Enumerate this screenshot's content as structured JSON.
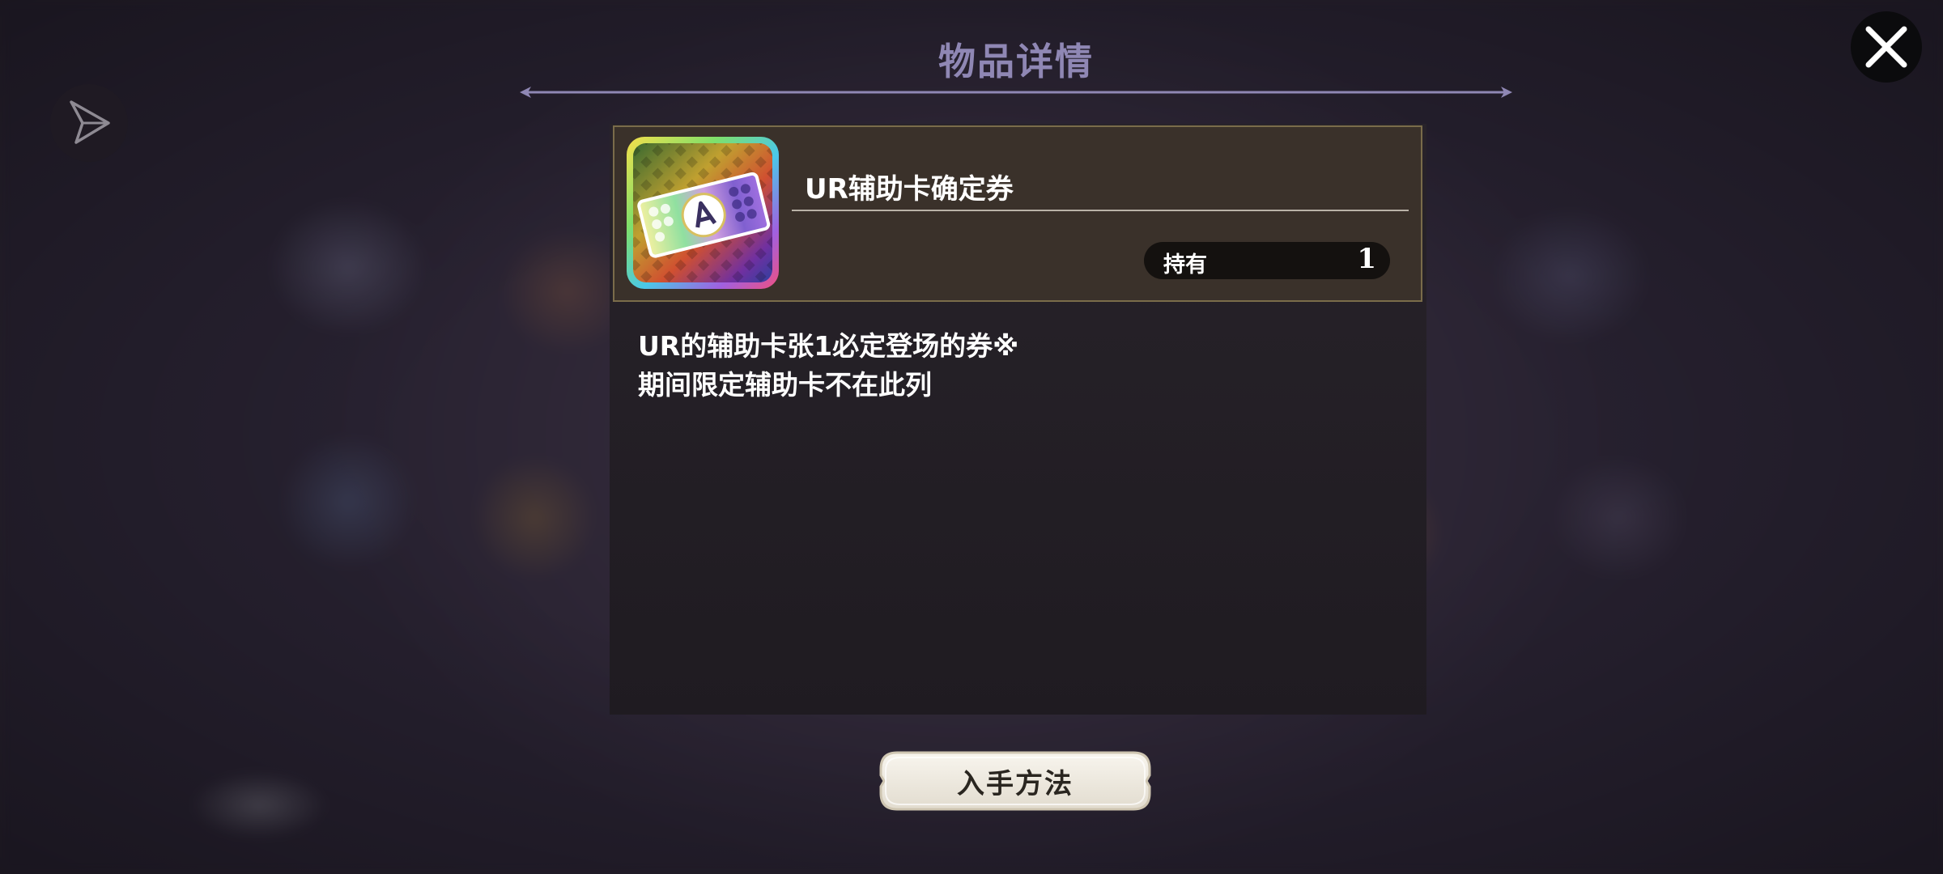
{
  "dialog": {
    "title": "物品详情",
    "close_icon": "close-icon",
    "share_icon": "share-icon"
  },
  "item": {
    "name": "UR辅助卡确定券",
    "owned_label": "持有",
    "owned_count": "1",
    "icon": "ticket-icon",
    "description_line1": "UR的辅助卡张1必定登场的券※",
    "description_line2": "期间限定辅助卡不在此列"
  },
  "actions": {
    "acquire_label": "入手方法"
  },
  "colors": {
    "title": "#8f87b4",
    "header_bg": "#3a312a",
    "header_border": "#7a6c4a"
  }
}
